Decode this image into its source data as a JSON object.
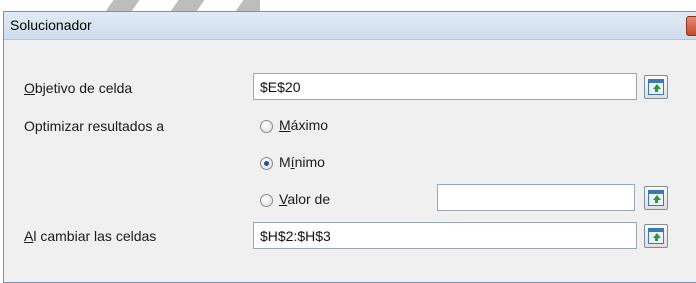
{
  "dialog": {
    "title": "Solucionador"
  },
  "objective": {
    "label_mnemonic": "O",
    "label_rest": "bjetivo de celda",
    "value": "$E$20"
  },
  "optimize": {
    "label": "Optimizar resultados a",
    "options": [
      {
        "mnemonic": "M",
        "rest": "áximo",
        "pre": "",
        "checked": false
      },
      {
        "pre": "M",
        "mnemonic": "í",
        "rest": "nimo",
        "checked": true
      },
      {
        "pre": "",
        "mnemonic": "V",
        "rest": "alor de",
        "checked": false
      }
    ],
    "value_of": ""
  },
  "changing": {
    "label_mnemonic": "A",
    "label_rest": "l cambiar las celdas",
    "value": "$H$2:$H$3"
  },
  "icons": {
    "cell_picker": "shrink-dialog-select-range-icon",
    "close": "close-icon"
  }
}
